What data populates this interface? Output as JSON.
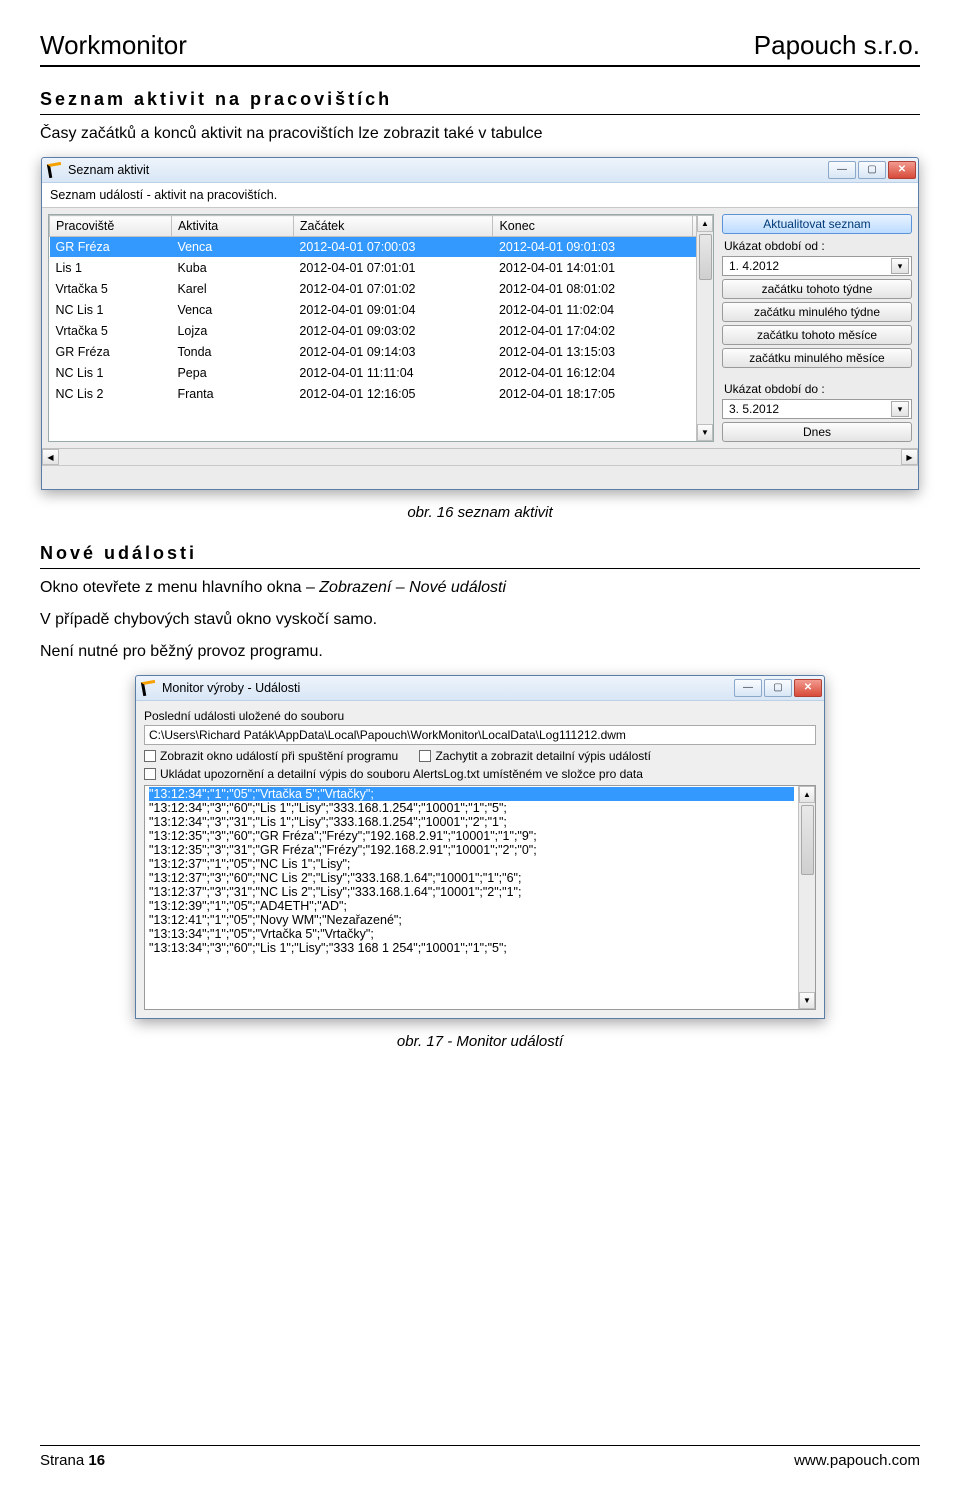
{
  "header": {
    "left": "Workmonitor",
    "right": "Papouch s.r.o."
  },
  "section1": {
    "title": "Seznam aktivit na pracovištích",
    "intro": "Časy začátků a konců aktivit na pracovištích lze zobrazit také v tabulce",
    "window_title": "Seznam aktivit",
    "banner": "Seznam událostí - aktivit na pracovištích.",
    "columns": [
      "Pracoviště",
      "Aktivita",
      "Začátek",
      "Konec"
    ],
    "rows": [
      {
        "p": "GR Fréza",
        "a": "Venca",
        "z": "2012-04-01 07:00:03",
        "k": "2012-04-01 09:01:03",
        "selected": true
      },
      {
        "p": "Lis 1",
        "a": "Kuba",
        "z": "2012-04-01 07:01:01",
        "k": "2012-04-01 14:01:01"
      },
      {
        "p": "Vrtačka 5",
        "a": "Karel",
        "z": "2012-04-01 07:01:02",
        "k": "2012-04-01 08:01:02"
      },
      {
        "p": "NC Lis 1",
        "a": "Venca",
        "z": "2012-04-01 09:01:04",
        "k": "2012-04-01 11:02:04"
      },
      {
        "p": "Vrtačka 5",
        "a": "Lojza",
        "z": "2012-04-01 09:03:02",
        "k": "2012-04-01 17:04:02"
      },
      {
        "p": "GR Fréza",
        "a": "Tonda",
        "z": "2012-04-01 09:14:03",
        "k": "2012-04-01 13:15:03"
      },
      {
        "p": "NC Lis 1",
        "a": "Pepa",
        "z": "2012-04-01 11:11:04",
        "k": "2012-04-01 16:12:04"
      },
      {
        "p": "NC Lis 2",
        "a": "Franta",
        "z": "2012-04-01 12:16:05",
        "k": "2012-04-01 18:17:05"
      }
    ],
    "side": {
      "refresh": "Aktualitovat seznam",
      "from_label": "Ukázat období od :",
      "from_date": "1.  4.2012",
      "btns_from": [
        "začátku tohoto týdne",
        "začátku minulého týdne",
        "začátku tohoto měsíce",
        "začátku minulého měsíce"
      ],
      "to_label": "Ukázat období do :",
      "to_date": "3.  5.2012",
      "btn_today": "Dnes"
    },
    "caption": "obr. 16 seznam aktivit"
  },
  "section2": {
    "title": "Nové události",
    "intro1a": "Okno otevřete z menu hlavního okna – ",
    "intro1b": "Zobrazení – Nové události",
    "intro2": "V případě chybových stavů okno vyskočí samo.",
    "intro3": "Není nutné pro běžný provoz programu.",
    "window_title": "Monitor výroby - Události",
    "line_last": "Poslední události uložené do souboru",
    "path": "C:\\Users\\Richard Paták\\AppData\\Local\\Papouch\\WorkMonitor\\LocalData\\Log111212.dwm",
    "chk1": "Zobrazit okno událostí při spuštění programu",
    "chk2": "Zachytit a zobrazit detailní výpis událostí",
    "chk3": "Ukládat upozornění a detailní výpis do souboru AlertsLog.txt umístěném ve složce pro data",
    "log": [
      "\"13:12:34\";\"1\";\"05\";\"Vrtačka 5\";\"Vrtačky\";",
      "\"13:12:34\";\"3\";\"60\";\"Lis 1\";\"Lisy\";\"333.168.1.254\";\"10001\";\"1\";\"5\";",
      "\"13:12:34\";\"3\";\"31\";\"Lis 1\";\"Lisy\";\"333.168.1.254\";\"10001\";\"2\";\"1\";",
      "\"13:12:35\";\"3\";\"60\";\"GR Fréza\";\"Frézy\";\"192.168.2.91\";\"10001\";\"1\";\"9\";",
      "\"13:12:35\";\"3\";\"31\";\"GR Fréza\";\"Frézy\";\"192.168.2.91\";\"10001\";\"2\";\"0\";",
      "\"13:12:37\";\"1\";\"05\";\"NC Lis 1\";\"Lisy\";",
      "\"13:12:37\";\"3\";\"60\";\"NC Lis 2\";\"Lisy\";\"333.168.1.64\";\"10001\";\"1\";\"6\";",
      "\"13:12:37\";\"3\";\"31\";\"NC Lis 2\";\"Lisy\";\"333.168.1.64\";\"10001\";\"2\";\"1\";",
      "\"13:12:39\";\"1\";\"05\";\"AD4ETH\";\"AD\";",
      "\"13:12:41\";\"1\";\"05\";\"Novy WM\";\"Nezařazené\";",
      "\"13:13:34\";\"1\";\"05\";\"Vrtačka 5\";\"Vrtačky\";",
      "\"13:13:34\";\"3\";\"60\";\"Lis 1\";\"Lisy\";\"333 168 1 254\";\"10001\";\"1\";\"5\";"
    ],
    "caption": "obr. 17 - Monitor událostí"
  },
  "footer": {
    "page_label": "Strana ",
    "page_num": "16",
    "url": "www.papouch.com"
  }
}
